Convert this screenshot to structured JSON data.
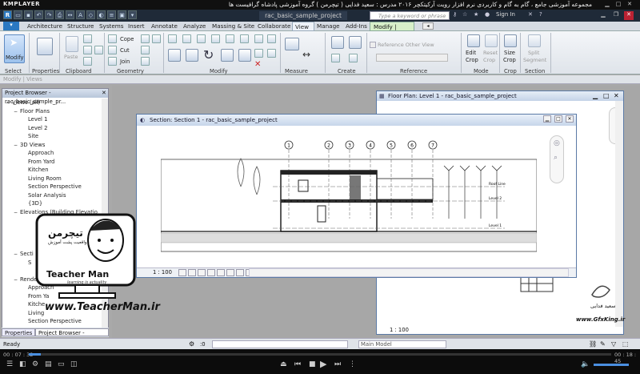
{
  "player": {
    "logo": "KMPLAYER",
    "title": "مجموعه آموزشی جامع ، گام به گام و کاربردی نرم افزار رویت آرکیتکچر ۲۰۱۶ مدرس : سعید فدایی ( تیچرمن ) گروه آموزشی پادشاه گرافیست ها",
    "time_elapsed": "00 : 07 : 32",
    "time_total": "00 : 18 : 45",
    "progress_fraction": 0.02
  },
  "revit": {
    "window_title": "rac_basic_sample_project",
    "search_placeholder": "Type a keyword or phrase",
    "sign_in": "Sign In",
    "tabs": [
      "Architecture",
      "Structure",
      "Systems",
      "Insert",
      "Annotate",
      "Analyze",
      "Massing & Site",
      "Collaborate",
      "View",
      "Manage",
      "Add-Ins"
    ],
    "context_tab": "Modify | Views",
    "panels": {
      "select": "Select",
      "properties": "Properties",
      "clipboard": "Clipboard",
      "geometry": "Geometry",
      "modify": "Modify",
      "measure": "Measure",
      "create": "Create",
      "reference": "Reference",
      "mode": "Mode",
      "crop": "Crop",
      "section": "Section"
    },
    "buttons": {
      "modify": "Modify",
      "paste": "Paste",
      "cope": "Cope",
      "cut": "Cut",
      "join": "Join",
      "reference_other_view": "Reference Other View",
      "edit_crop": "Edit Crop",
      "reset_crop": "Reset Crop",
      "size_crop": "Size Crop",
      "split_segment": "Split Segment"
    },
    "sub_bar": "Modify | Views",
    "project_browser": {
      "title": "Project Browser - rac_basic_sample_pr...",
      "tree": [
        {
          "label": "Views (all)",
          "level": 0,
          "toggle": "−"
        },
        {
          "label": "Floor Plans",
          "level": 1,
          "toggle": "−"
        },
        {
          "label": "Level 1",
          "level": 2,
          "toggle": ""
        },
        {
          "label": "Level 2",
          "level": 2,
          "toggle": ""
        },
        {
          "label": "Site",
          "level": 2,
          "toggle": ""
        },
        {
          "label": "3D Views",
          "level": 1,
          "toggle": "−"
        },
        {
          "label": "Approach",
          "level": 2,
          "toggle": ""
        },
        {
          "label": "From Yard",
          "level": 2,
          "toggle": ""
        },
        {
          "label": "Kitchen",
          "level": 2,
          "toggle": ""
        },
        {
          "label": "Living Room",
          "level": 2,
          "toggle": ""
        },
        {
          "label": "Section Perspective",
          "level": 2,
          "toggle": ""
        },
        {
          "label": "Solar Analysis",
          "level": 2,
          "toggle": ""
        },
        {
          "label": "{3D}",
          "level": 2,
          "toggle": ""
        },
        {
          "label": "Elevations (Building Elevatio",
          "level": 1,
          "toggle": "−"
        },
        {
          "label": "",
          "level": 2,
          "toggle": ""
        },
        {
          "label": "",
          "level": 2,
          "toggle": ""
        },
        {
          "label": "",
          "level": 2,
          "toggle": ""
        },
        {
          "label": "",
          "level": 2,
          "toggle": ""
        },
        {
          "label": "Secti",
          "level": 1,
          "toggle": "−"
        },
        {
          "label": "S",
          "level": 2,
          "toggle": ""
        },
        {
          "label": "",
          "level": 2,
          "toggle": ""
        },
        {
          "label": "Renderings",
          "level": 1,
          "toggle": "−"
        },
        {
          "label": "Approach",
          "level": 2,
          "toggle": ""
        },
        {
          "label": "From Ya",
          "level": 2,
          "toggle": ""
        },
        {
          "label": "Kitche",
          "level": 2,
          "toggle": ""
        },
        {
          "label": "Living",
          "level": 2,
          "toggle": ""
        },
        {
          "label": "Section Perspective",
          "level": 2,
          "toggle": ""
        }
      ],
      "tabs": [
        "Properties",
        "Project Browser - rac_basic_..."
      ]
    },
    "floor_plan_window": {
      "title": "Floor Plan: Level 1 - rac_basic_sample_project",
      "scale": "1 : 100"
    },
    "section_window": {
      "title": "Section: Section 1 - rac_basic_sample_project",
      "scale": "1 : 100",
      "grids": [
        "1",
        "2",
        "3",
        "4",
        "5",
        "6",
        "7"
      ],
      "level_labels": [
        "Roof Line",
        "Level 2",
        "Level 1"
      ]
    },
    "status": {
      "text": "Ready",
      "count": ":0",
      "model": "Main Model"
    }
  },
  "watermark": {
    "brand_fa": "تیچرمن",
    "brand_sub": "واقعیت پشت آموزش",
    "brand_en": "Teacher Man",
    "slogan": "learning is actuality",
    "site": "www.TeacherMan.ir",
    "gfx_name": "سعید فدایی",
    "gfx_site": "www.GfxKing.ir"
  },
  "colors": {
    "context_tab": "#d8efc9",
    "title_bar": "#1f2a38",
    "window_border": "#5b7aa6"
  }
}
